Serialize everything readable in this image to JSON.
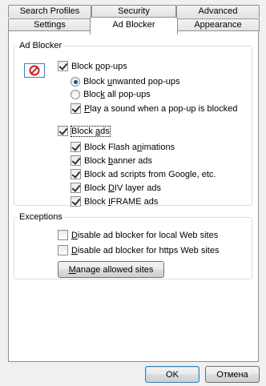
{
  "tabs": {
    "row1": [
      "Search Profiles",
      "Security",
      "Advanced"
    ],
    "row2": [
      "Settings",
      "Ad Blocker",
      "Appearance"
    ],
    "active": "Ad Blocker"
  },
  "ad_blocker": {
    "legend": "Ad Blocker",
    "icon": "no-entry-icon",
    "block_popups": {
      "pre": "Block ",
      "ul": "p",
      "post": "op-ups",
      "checked": true
    },
    "popup_mode": [
      {
        "pre": "Block ",
        "ul": "u",
        "post": "nwanted pop-ups",
        "checked": true
      },
      {
        "pre": "Bloc",
        "ul": "k",
        "post": " all pop-ups",
        "checked": false
      }
    ],
    "play_sound": {
      "pre": "",
      "ul": "P",
      "post": "lay a sound when a pop-up is blocked",
      "checked": true
    },
    "block_ads": {
      "pre": "Block ",
      "ul": "a",
      "post": "ds",
      "checked": true
    },
    "ad_types": [
      {
        "pre": "Block Flash a",
        "ul": "n",
        "post": "imations",
        "checked": true
      },
      {
        "pre": "Block ",
        "ul": "b",
        "post": "anner ads",
        "checked": true
      },
      {
        "pre": "Block ad scripts from Google, etc.",
        "ul": "",
        "post": "",
        "checked": true
      },
      {
        "pre": "Block ",
        "ul": "D",
        "post": "IV layer ads",
        "checked": true
      },
      {
        "pre": "Block ",
        "ul": "I",
        "post": "FRAME ads",
        "checked": true
      }
    ]
  },
  "exceptions": {
    "legend": "Exceptions",
    "items": [
      {
        "pre": "",
        "ul": "D",
        "post": "isable ad blocker for local Web sites",
        "checked": false
      },
      {
        "pre": "",
        "ul": "D",
        "post": "isable ad blocker for https Web sites",
        "checked": false
      }
    ],
    "manage_button": {
      "pre": "",
      "ul": "M",
      "post": "anage allowed sites"
    }
  },
  "footer": {
    "ok": "OK",
    "cancel": "Отмена"
  },
  "colors": {
    "icon_red": "#d21f1f",
    "frame_blue": "#4a7fb5"
  }
}
